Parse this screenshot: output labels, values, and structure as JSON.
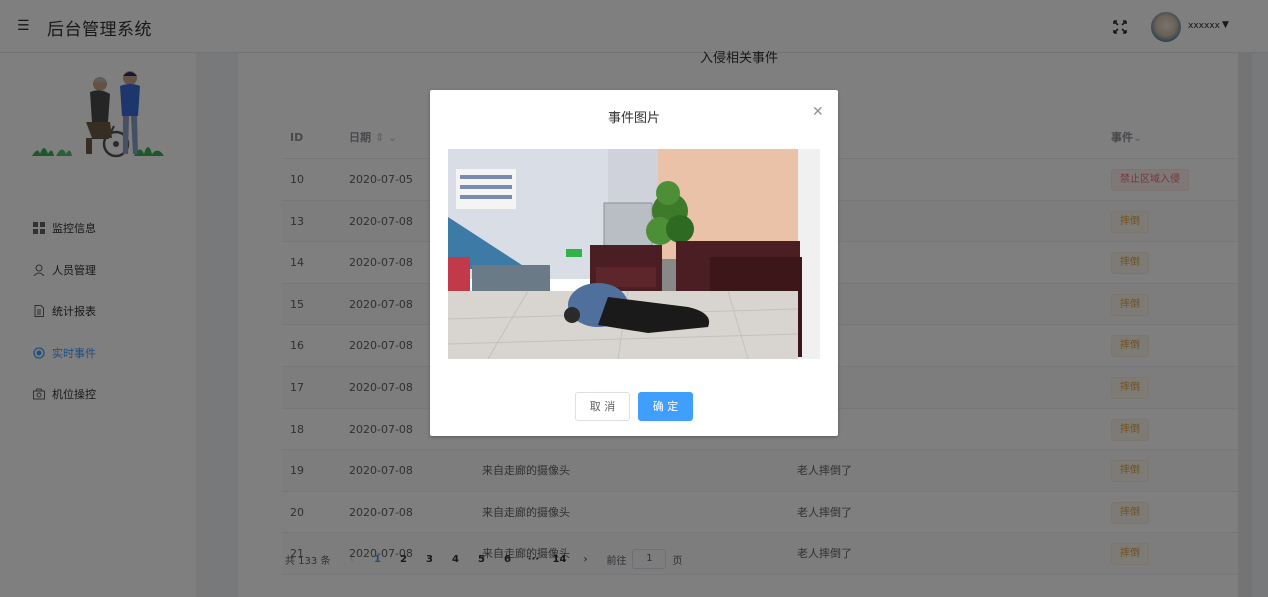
{
  "header": {
    "title": "后台管理系统",
    "username": "xxxxxx"
  },
  "sidebar": {
    "items": [
      {
        "label": "监控信息",
        "icon": "grid-icon",
        "active": false
      },
      {
        "label": "人员管理",
        "icon": "user-icon",
        "active": false
      },
      {
        "label": "统计报表",
        "icon": "document-icon",
        "active": false
      },
      {
        "label": "实时事件",
        "icon": "target-icon",
        "active": true
      },
      {
        "label": "机位操控",
        "icon": "camera-icon",
        "active": false
      }
    ]
  },
  "card": {
    "title": "入侵相关事件"
  },
  "table": {
    "headers": {
      "id": "ID",
      "date": "日期",
      "event": "事件"
    },
    "rows": [
      {
        "id": "10",
        "date": "2020-07-05",
        "source": "",
        "desc": "",
        "event": "禁止区域入侵",
        "type": "danger"
      },
      {
        "id": "13",
        "date": "2020-07-08",
        "source": "",
        "desc": "",
        "event": "摔倒",
        "type": "warning"
      },
      {
        "id": "14",
        "date": "2020-07-08",
        "source": "",
        "desc": "",
        "event": "摔倒",
        "type": "warning"
      },
      {
        "id": "15",
        "date": "2020-07-08",
        "source": "",
        "desc": "",
        "event": "摔倒",
        "type": "warning"
      },
      {
        "id": "16",
        "date": "2020-07-08",
        "source": "",
        "desc": "",
        "event": "摔倒",
        "type": "warning"
      },
      {
        "id": "17",
        "date": "2020-07-08",
        "source": "",
        "desc": "",
        "event": "摔倒",
        "type": "warning"
      },
      {
        "id": "18",
        "date": "2020-07-08",
        "source": "",
        "desc": "",
        "event": "摔倒",
        "type": "warning"
      },
      {
        "id": "19",
        "date": "2020-07-08",
        "source": "来自走廊的摄像头",
        "desc": "老人摔倒了",
        "event": "摔倒",
        "type": "warning"
      },
      {
        "id": "20",
        "date": "2020-07-08",
        "source": "来自走廊的摄像头",
        "desc": "老人摔倒了",
        "event": "摔倒",
        "type": "warning"
      },
      {
        "id": "21",
        "date": "2020-07-08",
        "source": "来自走廊的摄像头",
        "desc": "老人摔倒了",
        "event": "摔倒",
        "type": "warning"
      }
    ]
  },
  "pagination": {
    "total": "共 133 条",
    "pages": [
      "1",
      "2",
      "3",
      "4",
      "5",
      "6",
      "···",
      "14"
    ],
    "current": "1",
    "goto_label": "前往",
    "goto_value": "1",
    "page_unit": "页"
  },
  "dialog": {
    "title": "事件图片",
    "cancel_label": "取 消",
    "ok_label": "确 定"
  },
  "colors": {
    "primary": "#409eff",
    "danger": "#f56c6c",
    "warning": "#e6a23c"
  }
}
